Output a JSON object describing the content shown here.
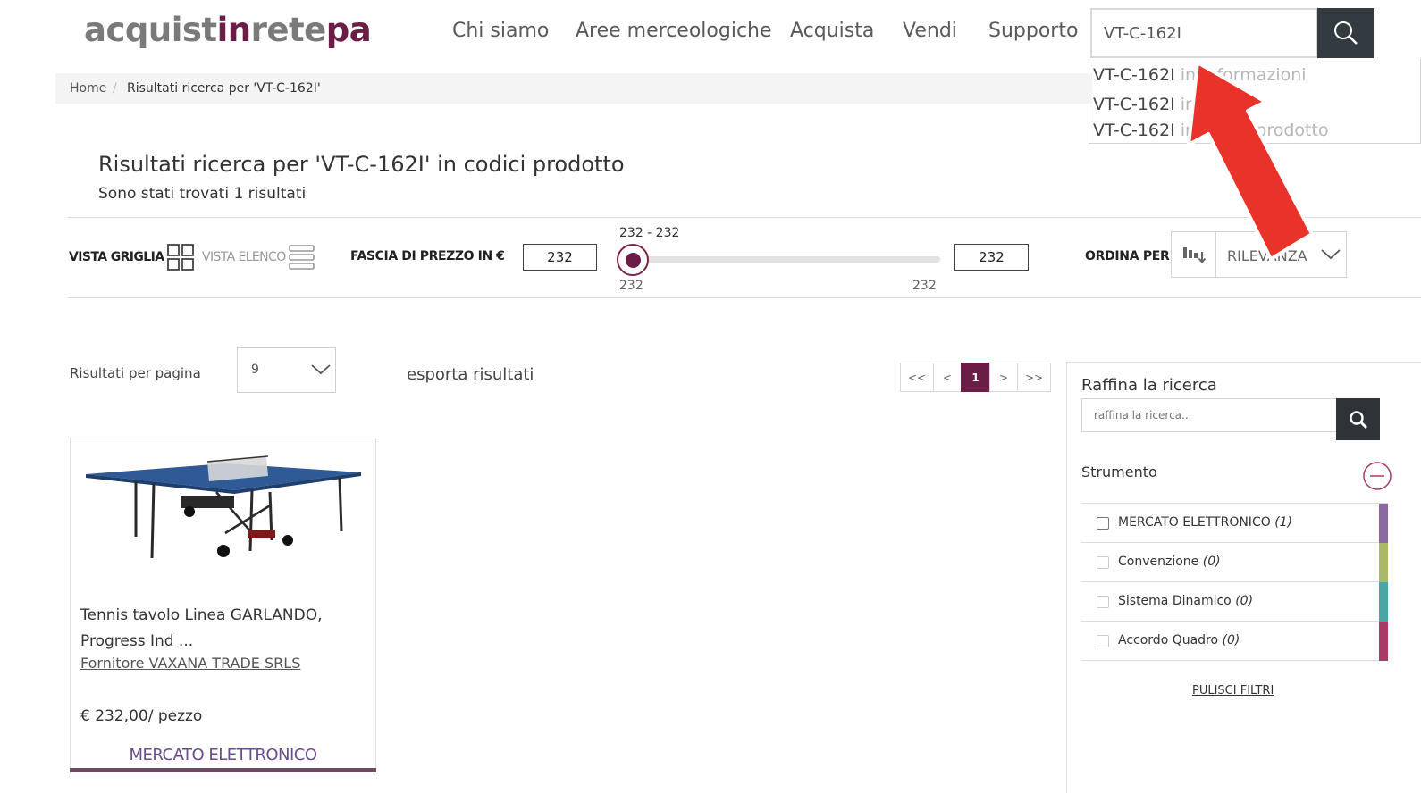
{
  "header": {
    "logo": {
      "part1": "acquist",
      "part2": "in",
      "part3": "rete",
      "part4": "pa"
    },
    "nav": [
      "Chi siamo",
      "Aree merceologiche",
      "Acquista",
      "Vendi",
      "Supporto"
    ],
    "search_value": "VT-C-162I",
    "suggestions": [
      {
        "code": "VT-C-162I",
        "rest": " in informazioni"
      },
      {
        "code": "VT-C-162I",
        "rest": " in"
      },
      {
        "code": "VT-C-162I",
        "rest": " in codici prodotto"
      }
    ]
  },
  "breadcrumb": {
    "home": "Home",
    "sep": "/",
    "current": "Risultati ricerca per 'VT-C-162I'"
  },
  "results": {
    "title": "Risultati ricerca per 'VT-C-162I' in codici prodotto",
    "subtitle": "Sono stati trovati 1 risultati"
  },
  "toolbar": {
    "grid_view": "VISTA GRIGLIA",
    "list_view": "VISTA ELENCO",
    "price_label": "FASCIA DI PREZZO IN €",
    "price_min": "232",
    "price_max": "232",
    "range_label": "232 - 232",
    "range_tick_min": "232",
    "range_tick_max": "232",
    "sort_label": "ORDINA PER",
    "sort_value": "RILEVANZA"
  },
  "listing": {
    "per_page_label": "Risultati per pagina",
    "per_page_value": "9",
    "export": "esporta risultati",
    "pager": [
      "<<",
      "<",
      "1",
      ">",
      ">>"
    ]
  },
  "product": {
    "title_line1": "Tennis tavolo Linea GARLANDO,",
    "title_line2": "Progress Ind ...",
    "supplier": "Fornitore VAXANA TRADE SRLS",
    "price": "€ 232,00/ pezzo",
    "channel": "MERCATO ELETTRONICO"
  },
  "refine": {
    "title": "Raffina la ricerca",
    "placeholder": "raffina la ricerca...",
    "group_title": "Strumento",
    "filters": [
      {
        "label": "MERCATO ELETTRONICO",
        "count": "(1)",
        "color": "#8a6aa0"
      },
      {
        "label": "Convenzione",
        "count": "(0)",
        "color": "#aab86a"
      },
      {
        "label": "Sistema Dinamico",
        "count": "(0)",
        "color": "#4aa5a5"
      },
      {
        "label": "Accordo Quadro",
        "count": "(0)",
        "color": "#a83a66"
      }
    ],
    "clear": "PULISCI FILTRI"
  },
  "colors": {
    "brand": "#6b1d45",
    "annotation_arrow": "#e8322a"
  }
}
